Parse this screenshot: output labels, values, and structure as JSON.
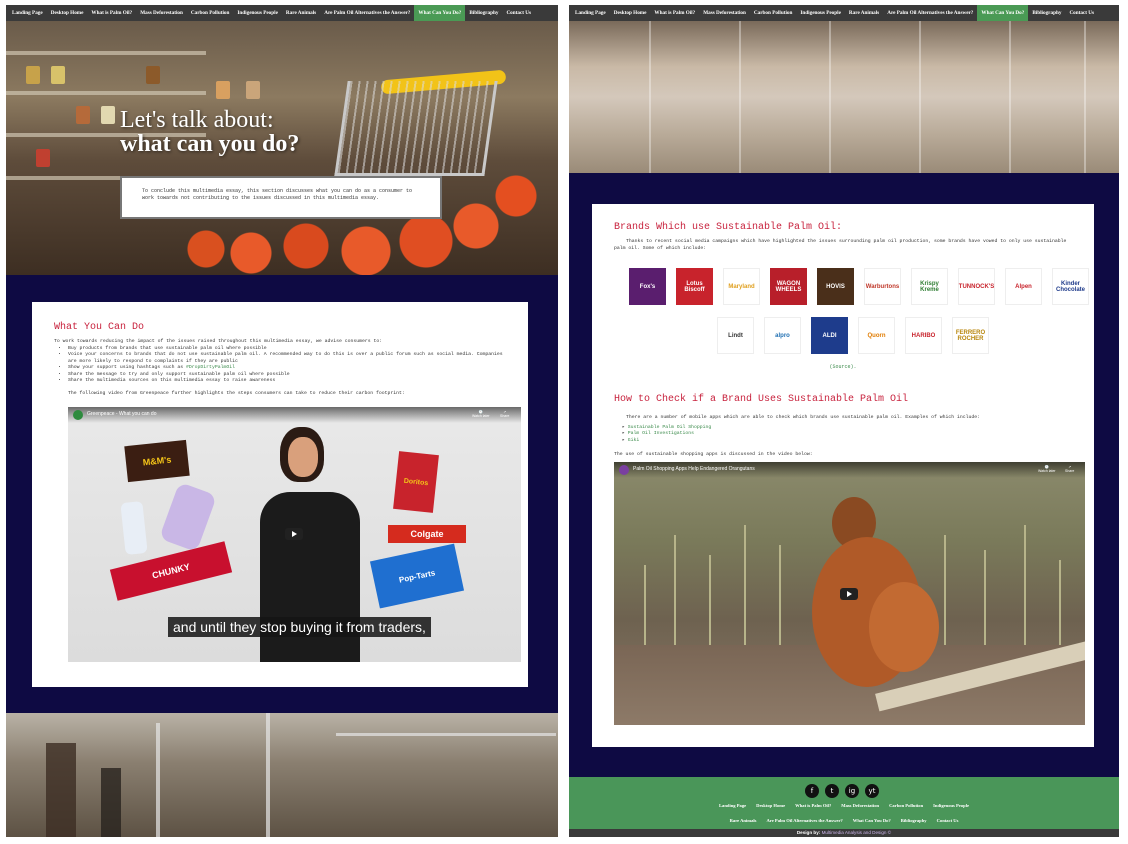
{
  "nav": {
    "items": [
      "Landing Page",
      "Desktop Home",
      "What is Palm Oil?",
      "Mass Deforestation",
      "Carbon Pollution",
      "Indigenous People",
      "Rare Animals",
      "Are Palm Oil Alternatives the Answer?",
      "What Can You Do?",
      "Bibliography",
      "Contact Us"
    ],
    "active_index": 8
  },
  "hero": {
    "line1": "Let's talk about:",
    "line2": "what can you do?",
    "intro": "To conclude this multimedia essay, this section discusses what you can do as a consumer to work towards not contributing to the issues discussed in this multimedia essay."
  },
  "what_you_can_do": {
    "heading": "What You Can Do",
    "intro": "To work towards reducing the impact of the issues raised throughout this multimedia essay, we advise consumers to:",
    "bullets": [
      "Buy products from brands that use sustainable palm oil where possible",
      "Voice your concerns to brands that do not use sustainable palm oil. A recommended way to do this is over a public forum such as social media. Companies are more likely to respond to complaints if they are public",
      "Show your support using hashtags such as #DropDirtyPalmOil",
      "Share the message to try and only support sustainable palm oil where possible",
      "Share the multimedia sources on this multimedia essay to raise awareness"
    ],
    "hashtag": "#DropDirtyPalmOil",
    "video_intro": "The following video from Greenpeace further highlights the steps consumers can take to reduce their carbon footprint:",
    "video": {
      "title": "Greenpeace - What you can do",
      "caption": "and until they stop buying it from traders,",
      "watch_later": "Watch later",
      "share": "Share"
    },
    "products": [
      "M&M's",
      "Doritos",
      "Colgate",
      "CHUNKY",
      "Pop-Tarts"
    ]
  },
  "brands": {
    "heading": "Brands Which use Sustainable Palm Oil:",
    "intro": "Thanks to recent social media campaigns which have highlighted the issues surrounding palm oil production, some brands have vowed to only use sustainable palm oil. Some of which include:",
    "logos_row1": [
      {
        "label": "Fox's",
        "bg": "#5a1e6e",
        "fg": "#ffffff"
      },
      {
        "label": "Lotus Biscoff",
        "bg": "#c8232c",
        "fg": "#ffffff"
      },
      {
        "label": "Maryland",
        "bg": "#ffffff",
        "fg": "#e0a020"
      },
      {
        "label": "WAGON WHEELS",
        "bg": "#b81f2a",
        "fg": "#ffffff"
      },
      {
        "label": "HOVIS",
        "bg": "#4a2f1a",
        "fg": "#ffffff"
      },
      {
        "label": "Warburtons",
        "bg": "#ffffff",
        "fg": "#c0392b"
      },
      {
        "label": "Krispy Kreme",
        "bg": "#ffffff",
        "fg": "#2e7d32"
      },
      {
        "label": "TUNNOCK'S",
        "bg": "#ffffff",
        "fg": "#c8232c"
      },
      {
        "label": "Alpen",
        "bg": "#ffffff",
        "fg": "#c8232c"
      },
      {
        "label": "Kinder Chocolate",
        "bg": "#ffffff",
        "fg": "#1e3a8a"
      }
    ],
    "logos_row2": [
      {
        "label": "Lindt",
        "bg": "#ffffff",
        "fg": "#333333"
      },
      {
        "label": "alpro",
        "bg": "#ffffff",
        "fg": "#1f6fb2"
      },
      {
        "label": "ALDI",
        "bg": "#1e3c8c",
        "fg": "#ffffff"
      },
      {
        "label": "Quorn",
        "bg": "#ffffff",
        "fg": "#e07b00"
      },
      {
        "label": "HARIBO",
        "bg": "#ffffff",
        "fg": "#c8232c"
      },
      {
        "label": "FERRERO ROCHER",
        "bg": "#ffffff",
        "fg": "#b8860b"
      }
    ],
    "source": "(Source)."
  },
  "check": {
    "heading": "How to Check if a Brand Uses Sustainable Palm Oil",
    "intro": "There are a number of mobile apps which are able to check which brands use sustainable palm oil. Examples of which include:",
    "apps": [
      "Sustainable Palm Oil Shopping",
      "Palm Oil Investigations",
      "Giki"
    ],
    "video_intro": "The use of sustainable shopping apps is discussed in the video below:",
    "video": {
      "title": "Palm Oil Shopping Apps Help Endangered Orangutans",
      "watch_later": "Watch later",
      "share": "Share"
    }
  },
  "footer": {
    "social": [
      "f",
      "t",
      "ig",
      "yt"
    ],
    "links_row1": [
      "Landing Page",
      "Desktop Home",
      "What is Palm Oil?",
      "Mass Deforestation",
      "Carbon Pollution",
      "Indigenous People"
    ],
    "links_row2": [
      "Rare Animals",
      "Are Palm Oil Alternatives the Answer?",
      "What Can You Do?",
      "Bibliography",
      "Contact Us"
    ],
    "credit_prefix": "Design by:",
    "credit_link": "Multimedia Analysis and Design ©"
  },
  "colors": {
    "navy": "#0e0a43",
    "heading_red": "#c8233e",
    "nav_active": "#4a9a55",
    "footer_green": "#4a9659"
  }
}
